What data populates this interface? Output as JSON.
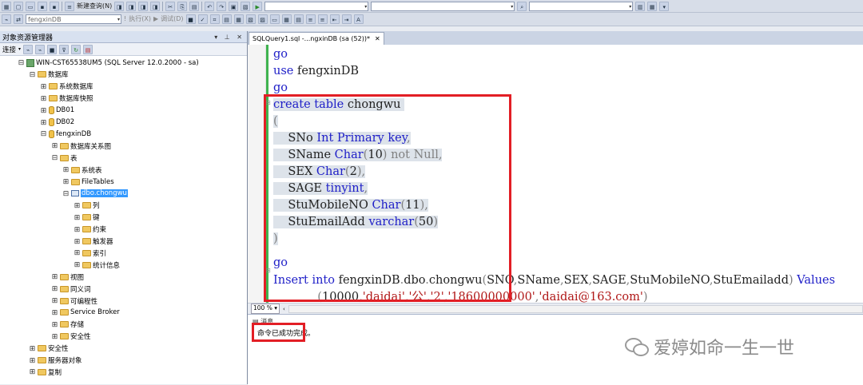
{
  "toolbar1": {
    "new_query": "新建查询(N)"
  },
  "toolbar2": {
    "database_combo": "fengxinDB",
    "execute": "执行(X)",
    "debug": "调试(D)"
  },
  "object_explorer": {
    "title": "对象资源管理器",
    "title_controls": "▾ ⊥ ✕",
    "connect_label": "连接",
    "tree": [
      {
        "label": "WIN-CST65538UM5 (SQL Server 12.0.2000 - sa)",
        "icon": "server-icon",
        "expand": "⊟"
      },
      {
        "label": "数据库",
        "icon": "folder-icon",
        "expand": "⊟"
      },
      {
        "label": "系统数据库",
        "icon": "folder-icon",
        "expand": "⊞"
      },
      {
        "label": "数据库快照",
        "icon": "folder-icon",
        "expand": "⊞"
      },
      {
        "label": "DB01",
        "icon": "database-icon",
        "expand": "⊞"
      },
      {
        "label": "DB02",
        "icon": "database-icon",
        "expand": "⊞"
      },
      {
        "label": "fengxinDB",
        "icon": "database-icon",
        "expand": "⊟"
      },
      {
        "label": "数据库关系图",
        "icon": "folder-icon",
        "expand": "⊞"
      },
      {
        "label": "表",
        "icon": "folder-icon",
        "expand": "⊟"
      },
      {
        "label": "系统表",
        "icon": "folder-icon",
        "expand": "⊞"
      },
      {
        "label": "FileTables",
        "icon": "folder-icon",
        "expand": "⊞"
      },
      {
        "label": "dbo.chongwu",
        "icon": "table-icon",
        "expand": "⊟"
      },
      {
        "label": "列",
        "icon": "folder-icon",
        "expand": "⊞"
      },
      {
        "label": "键",
        "icon": "folder-icon",
        "expand": "⊞"
      },
      {
        "label": "约束",
        "icon": "folder-icon",
        "expand": "⊞"
      },
      {
        "label": "触发器",
        "icon": "folder-icon",
        "expand": "⊞"
      },
      {
        "label": "索引",
        "icon": "folder-icon",
        "expand": "⊞"
      },
      {
        "label": "统计信息",
        "icon": "folder-icon",
        "expand": "⊞"
      },
      {
        "label": "视图",
        "icon": "folder-icon",
        "expand": "⊞"
      },
      {
        "label": "同义词",
        "icon": "folder-icon",
        "expand": "⊞"
      },
      {
        "label": "可编程性",
        "icon": "folder-icon",
        "expand": "⊞"
      },
      {
        "label": "Service Broker",
        "icon": "folder-icon",
        "expand": "⊞"
      },
      {
        "label": "存储",
        "icon": "folder-icon",
        "expand": "⊞"
      },
      {
        "label": "安全性",
        "icon": "folder-icon",
        "expand": "⊞"
      },
      {
        "label": "安全性",
        "icon": "folder-icon",
        "expand": "⊞"
      },
      {
        "label": "服务器对象",
        "icon": "folder-icon",
        "expand": "⊞"
      },
      {
        "label": "复制",
        "icon": "folder-icon",
        "expand": "⊞"
      }
    ]
  },
  "editor": {
    "tab_label": "SQLQuery1.sql -...ngxinDB (sa (52))*",
    "tab_close": "✕",
    "lines": [
      [
        {
          "t": "go",
          "c": "kw"
        }
      ],
      [
        {
          "t": "use",
          "c": "kw"
        },
        {
          "t": " fengxinDB",
          "c": "bk"
        }
      ],
      [
        {
          "t": "go",
          "c": "kw"
        }
      ],
      [
        {
          "t": "create table",
          "c": "kw"
        },
        {
          "t": " chongwu ",
          "c": "bk"
        }
      ],
      [
        {
          "t": "(",
          "c": "gy"
        }
      ],
      [
        {
          "t": "    SNo ",
          "c": "bk"
        },
        {
          "t": "Int Primary key",
          "c": "kw"
        },
        {
          "t": ",",
          "c": "gy"
        }
      ],
      [
        {
          "t": "    SName ",
          "c": "bk"
        },
        {
          "t": "Char",
          "c": "kw"
        },
        {
          "t": "(",
          "c": "gy"
        },
        {
          "t": "10",
          "c": "bk"
        },
        {
          "t": ") not Null,",
          "c": "gy"
        }
      ],
      [
        {
          "t": "    SEX ",
          "c": "bk"
        },
        {
          "t": "Char",
          "c": "kw"
        },
        {
          "t": "(",
          "c": "gy"
        },
        {
          "t": "2",
          "c": "bk"
        },
        {
          "t": "),",
          "c": "gy"
        }
      ],
      [
        {
          "t": "    SAGE ",
          "c": "bk"
        },
        {
          "t": "tinyint",
          "c": "kw"
        },
        {
          "t": ",",
          "c": "gy"
        }
      ],
      [
        {
          "t": "    StuMobileNO ",
          "c": "bk"
        },
        {
          "t": "Char",
          "c": "kw"
        },
        {
          "t": "(",
          "c": "gy"
        },
        {
          "t": "11",
          "c": "bk"
        },
        {
          "t": "),",
          "c": "gy"
        }
      ],
      [
        {
          "t": "    StuEmailAdd ",
          "c": "bk"
        },
        {
          "t": "varchar",
          "c": "kw"
        },
        {
          "t": "(",
          "c": "gy"
        },
        {
          "t": "50",
          "c": "bk"
        },
        {
          "t": ")",
          "c": "gy"
        }
      ],
      [
        {
          "t": ")",
          "c": "gy"
        }
      ],
      [
        {
          "t": "",
          "c": "bk"
        }
      ],
      [
        {
          "t": "go",
          "c": "kw"
        }
      ],
      [
        {
          "t": "Insert into",
          "c": "kw"
        },
        {
          "t": " fengxinDB",
          "c": "bk"
        },
        {
          "t": ".",
          "c": "gy"
        },
        {
          "t": "dbo",
          "c": "bk"
        },
        {
          "t": ".",
          "c": "gy"
        },
        {
          "t": "chongwu",
          "c": "bk"
        },
        {
          "t": "(",
          "c": "gy"
        },
        {
          "t": "SNO",
          "c": "bk"
        },
        {
          "t": ",",
          "c": "gy"
        },
        {
          "t": "SName",
          "c": "bk"
        },
        {
          "t": ",",
          "c": "gy"
        },
        {
          "t": "SEX",
          "c": "bk"
        },
        {
          "t": ",",
          "c": "gy"
        },
        {
          "t": "SAGE",
          "c": "bk"
        },
        {
          "t": ",",
          "c": "gy"
        },
        {
          "t": "StuMobileNO",
          "c": "bk"
        },
        {
          "t": ",",
          "c": "gy"
        },
        {
          "t": "StuEmailadd",
          "c": "bk"
        },
        {
          "t": ") ",
          "c": "gy"
        },
        {
          "t": "Values",
          "c": "kw"
        }
      ],
      [
        {
          "t": "            (",
          "c": "gy"
        },
        {
          "t": "10000",
          "c": "bk"
        },
        {
          "t": ",",
          "c": "gy"
        },
        {
          "t": "'daidai'",
          "c": "str"
        },
        {
          "t": ",",
          "c": "gy"
        },
        {
          "t": "'公'",
          "c": "str"
        },
        {
          "t": ",",
          "c": "gy"
        },
        {
          "t": "'2'",
          "c": "str"
        },
        {
          "t": ",",
          "c": "gy"
        },
        {
          "t": "'18600000000'",
          "c": "str"
        },
        {
          "t": ",",
          "c": "gy"
        },
        {
          "t": "'daidai@163.com'",
          "c": "str"
        },
        {
          "t": ")",
          "c": "gy"
        }
      ]
    ],
    "fold_marks": [
      "⊟",
      "⊟"
    ]
  },
  "zoom": "100 %",
  "results": {
    "tab_label": "消息",
    "message": "命令已成功完成。"
  },
  "watermark": "爱婷如命一生一世"
}
